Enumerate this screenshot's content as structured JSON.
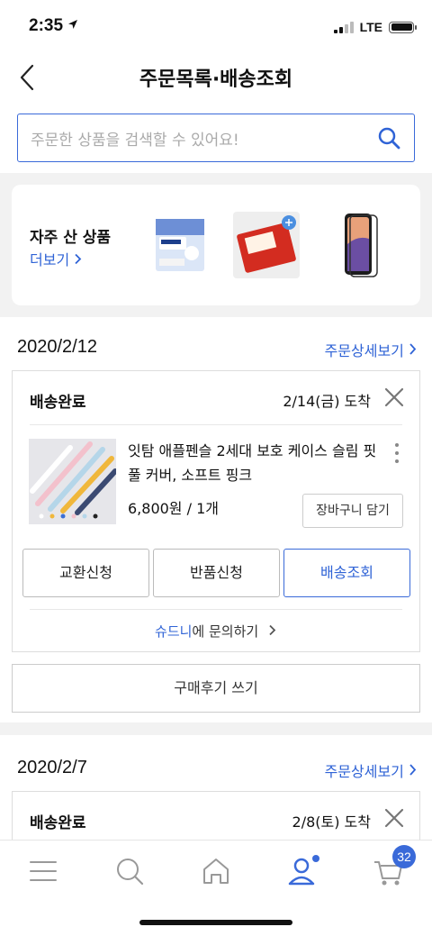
{
  "status_bar": {
    "time": "2:35",
    "network": "LTE"
  },
  "header": {
    "title": "주문목록·배송조회"
  },
  "search": {
    "placeholder": "주문한 상품을 검색할 수 있어요!"
  },
  "frequent": {
    "title": "자주 산 상품",
    "more_label": "더보기",
    "items": [
      {
        "name": "화이트 생리대"
      },
      {
        "name": "냉동 식품"
      },
      {
        "name": "휴대폰 케이스"
      }
    ]
  },
  "orders": [
    {
      "date": "2020/2/12",
      "detail_link": "주문상세보기",
      "status": "배송완료",
      "arrival": "2/14(금) 도착",
      "product_name": "잇탐 애플펜슬 2세대 보호 케이스 슬림 핏 풀 커버, 소프트 핑크",
      "price_qty": "6,800원 / 1개",
      "cart_button": "장바구니 담기",
      "actions": [
        "교환신청",
        "반품신청",
        "배송조회"
      ],
      "seller": "슈드니",
      "inquiry_suffix": "에 문의하기",
      "review_button": "구매후기 쓰기"
    },
    {
      "date": "2020/2/7",
      "detail_link": "주문상세보기",
      "status": "배송완료",
      "arrival": "2/8(토) 도착"
    }
  ],
  "tab_bar": {
    "items": [
      "menu",
      "search",
      "home",
      "my-account",
      "cart"
    ],
    "cart_count": "32"
  },
  "colors": {
    "accent": "#2f63d6",
    "badge": "#3a6ad9"
  }
}
